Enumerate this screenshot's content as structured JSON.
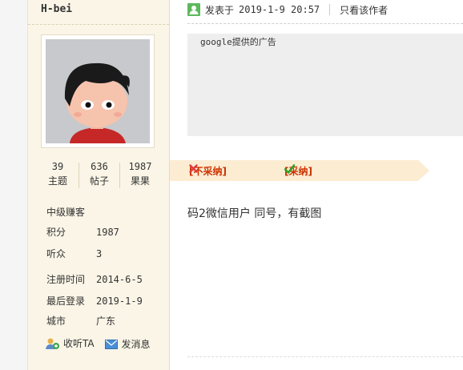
{
  "author": {
    "name": "H-bei",
    "stats": [
      {
        "value": "39",
        "label": "主题"
      },
      {
        "value": "636",
        "label": "帖子"
      },
      {
        "value": "1987",
        "label": "果果"
      }
    ],
    "rank": "中级赚客",
    "fields": [
      {
        "key": "积分",
        "value": "1987"
      },
      {
        "key": "听众",
        "value": "3"
      },
      {
        "key": "注册时间",
        "value": "2014-6-5"
      },
      {
        "key": "最后登录",
        "value": "2019-1-9"
      },
      {
        "key": "城市",
        "value": "广东"
      }
    ],
    "actions": {
      "follow": "收听TA",
      "message": "发消息"
    }
  },
  "post": {
    "posted_label": "发表于",
    "posted_time": "2019-1-9 20:57",
    "author_only": "只看该作者",
    "ad_text": "google提供的广告",
    "reject": "[❌不采纳]",
    "reject_open": "[",
    "reject_label": "不采纳",
    "reject_close": "]",
    "accept_open": "[",
    "accept_label": "采纳",
    "accept_close": "]",
    "content": "码2微信用户 同号，有截图"
  },
  "colors": {
    "sidebar_bg": "#faf5e7",
    "vote_bar_bg": "#fcecd2",
    "vote_text": "#cc3300",
    "accept_check": "#2aa52a",
    "reject_x": "#e03c3c"
  }
}
